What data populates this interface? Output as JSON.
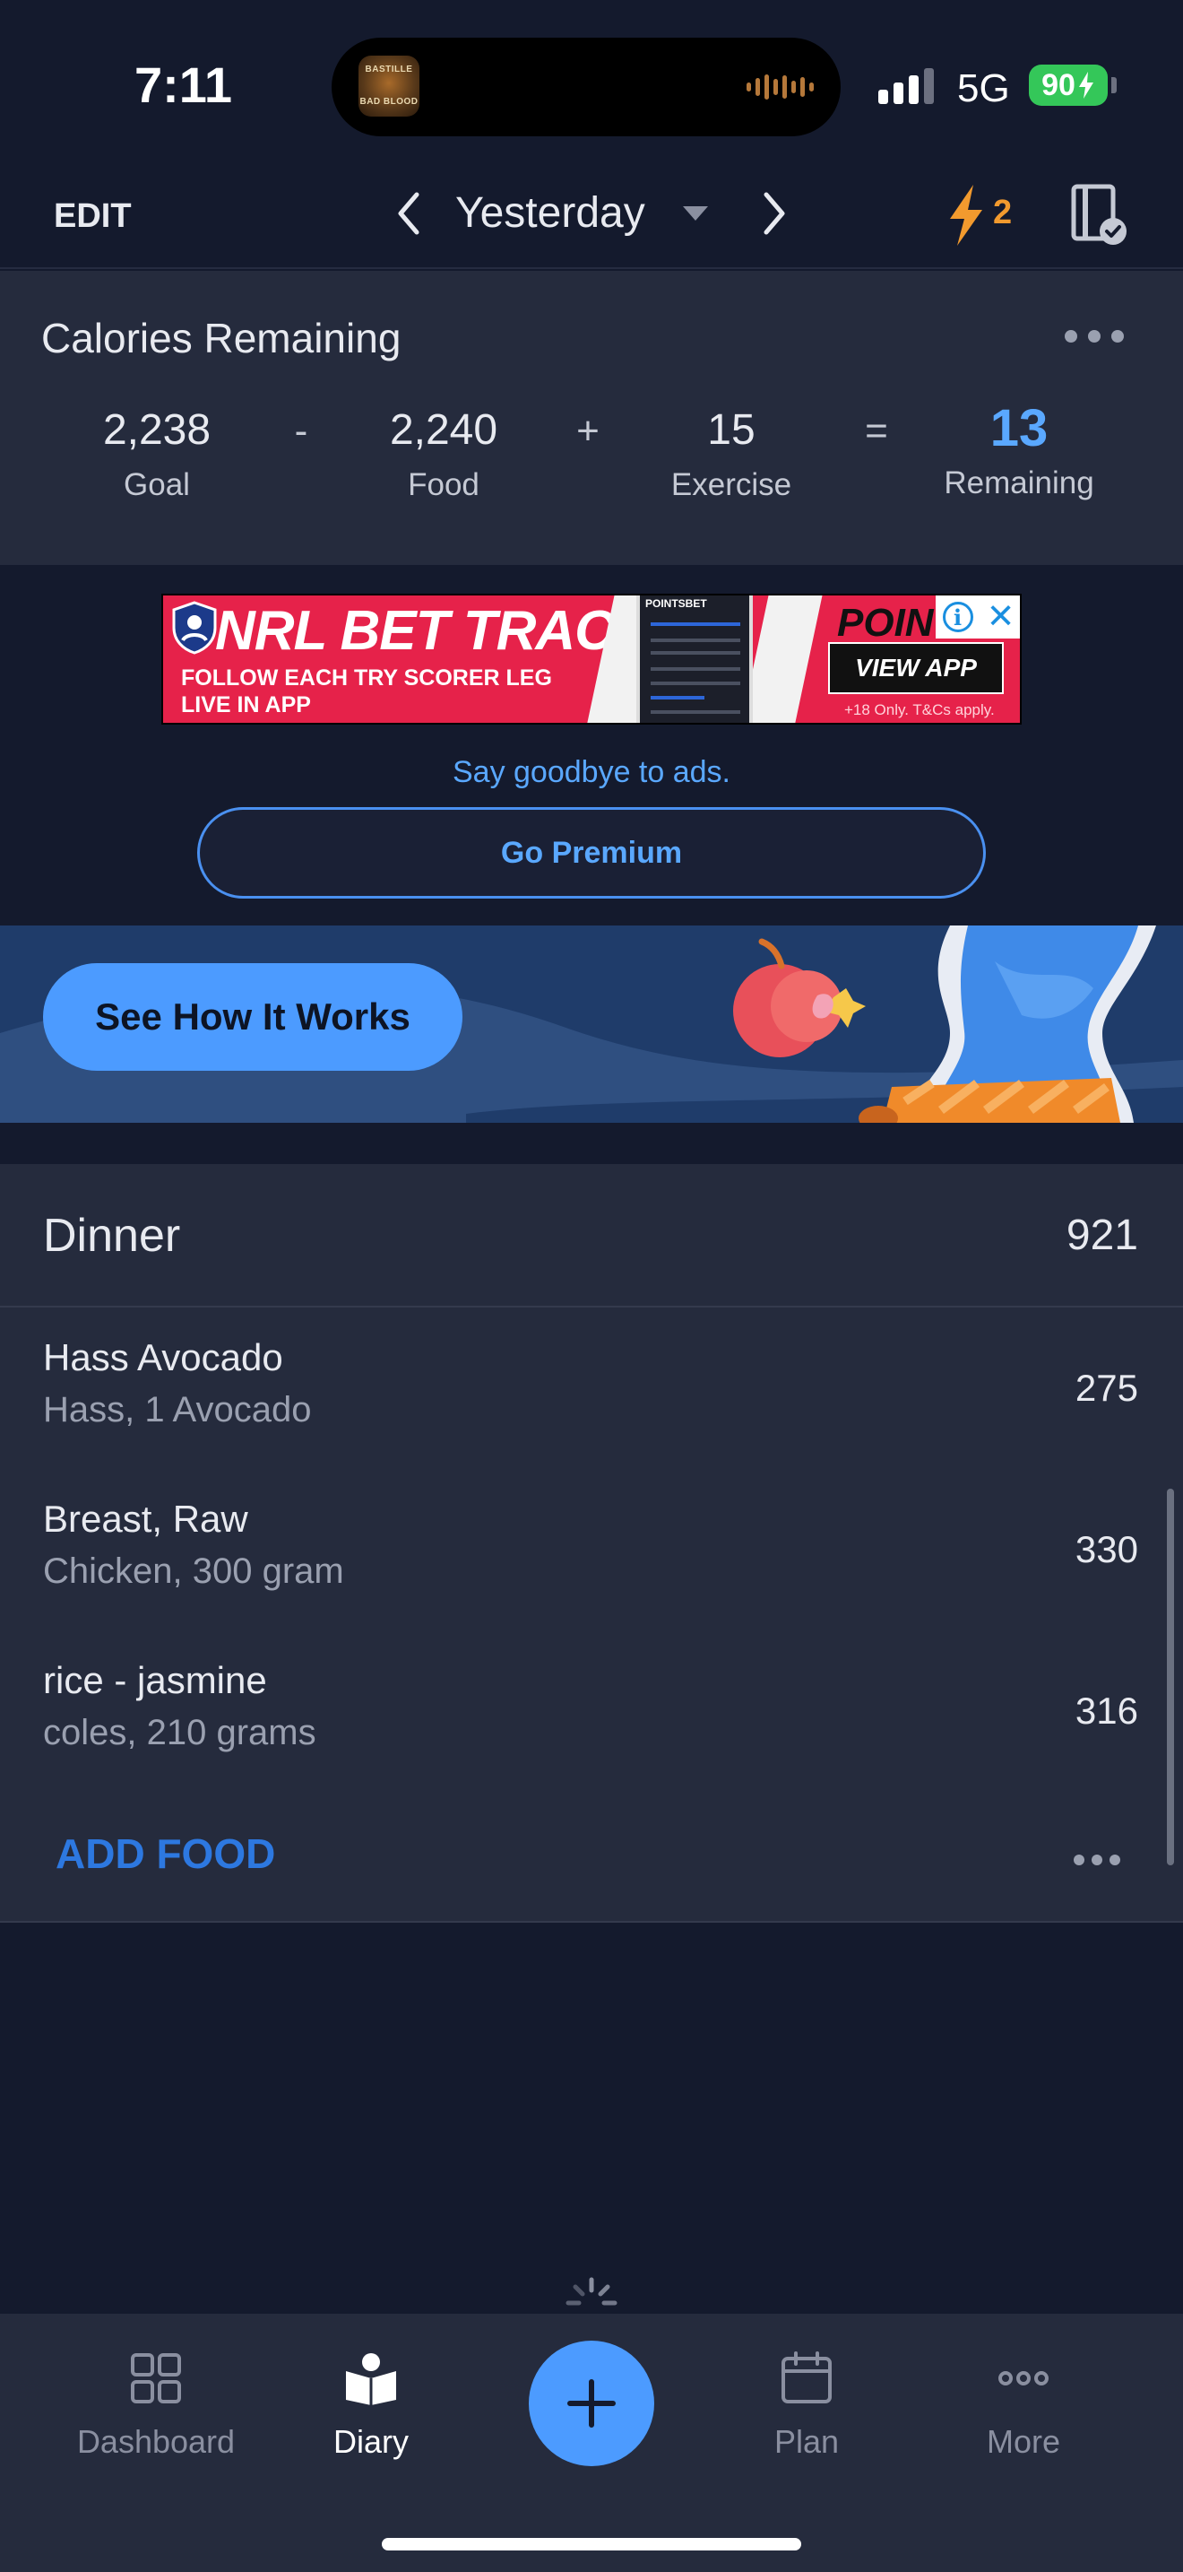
{
  "status_bar": {
    "time": "7:11",
    "album_text_top": "BASTILLE",
    "album_text_bottom": "BAD BLOOD",
    "network": "5G",
    "battery": "90"
  },
  "header": {
    "edit_label": "EDIT",
    "day_label": "Yesterday",
    "streak_count": "2"
  },
  "calories": {
    "title": "Calories Remaining",
    "goal_value": "2,238",
    "goal_label": "Goal",
    "minus": "-",
    "food_value": "2,240",
    "food_label": "Food",
    "plus": "+",
    "exercise_value": "15",
    "exercise_label": "Exercise",
    "equals": "=",
    "remaining_value": "13",
    "remaining_label": "Remaining"
  },
  "ad": {
    "headline": "NRL BET TRACKER",
    "line1": "FOLLOW EACH TRY SCORER LEG",
    "line2": "LIVE IN APP",
    "brand": "POINTS",
    "phone_brand": "POINTSBET",
    "cta": "VIEW APP",
    "disclaimer": "+18 Only. T&Cs apply.",
    "goodbye_text": "Say goodbye to ads.",
    "premium_label": "Go Premium"
  },
  "promo": {
    "button_label": "See How It Works"
  },
  "dinner": {
    "title": "Dinner",
    "total": "921",
    "items": [
      {
        "name": "Hass Avocado",
        "desc": "Hass, 1 Avocado",
        "cal": "275"
      },
      {
        "name": "Breast, Raw",
        "desc": "Chicken, 300 gram",
        "cal": "330"
      },
      {
        "name": "rice - jasmine",
        "desc": "coles, 210 grams",
        "cal": "316"
      }
    ],
    "add_food_label": "ADD FOOD"
  },
  "tabs": [
    {
      "label": "Dashboard",
      "icon": "dashboard-icon"
    },
    {
      "label": "Diary",
      "icon": "diary-icon"
    },
    {
      "label": "Plan",
      "icon": "calendar-icon"
    },
    {
      "label": "More",
      "icon": "more-icon"
    }
  ],
  "colors": {
    "accent": "#4c9bff",
    "remaining": "#5aa8ff",
    "streak": "#f29a2e",
    "ad_red": "#e6224a"
  }
}
